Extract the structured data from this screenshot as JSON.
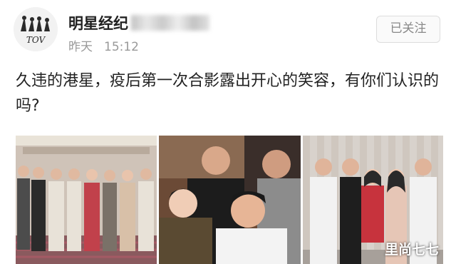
{
  "post": {
    "avatar_logo_text": "TOV",
    "username": "明星经纪",
    "timestamp_day": "昨天",
    "timestamp_time": "15:12",
    "follow_label": "已关注",
    "content": "久违的港星，疫后第一次合影露出开心的笑容，有你们认识的吗?"
  },
  "photos": [
    {
      "name": "group-photo-hallway"
    },
    {
      "name": "selfie-photo"
    },
    {
      "name": "group-photo-curtain"
    }
  ],
  "watermark": "里尚七七",
  "colors": {
    "text": "#222222",
    "meta": "#999999",
    "follow_border": "#dddddd"
  }
}
